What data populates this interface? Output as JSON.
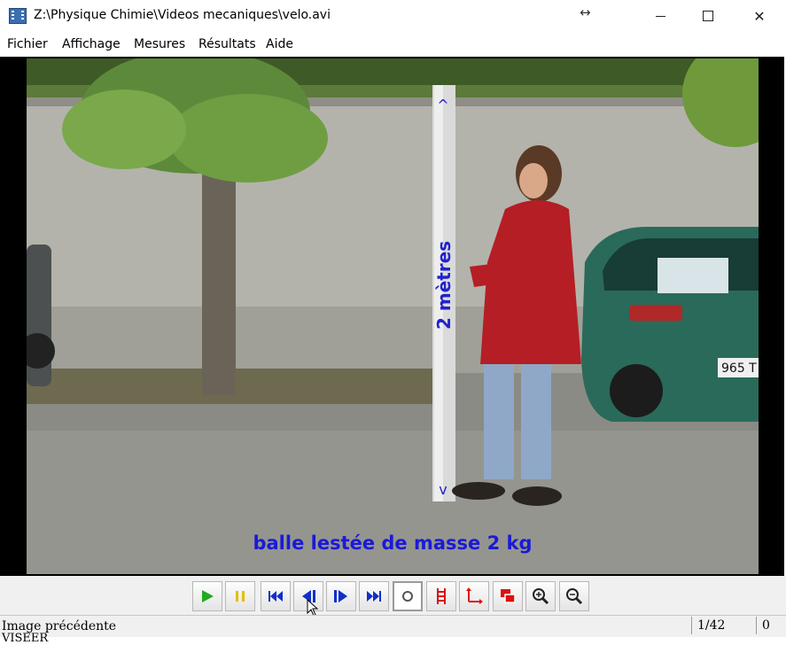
{
  "window": {
    "title": "Z:\\Physique Chimie\\Videos mecaniques\\velo.avi",
    "resize_glyph": "↔",
    "close_glyph": "✕"
  },
  "menu": [
    "Fichier",
    "Affichage",
    "Mesures",
    "Résultats",
    "Aide"
  ],
  "video": {
    "pole_label": "2 mètres",
    "caption": "balle lestée de masse 2 kg",
    "plate": "965 T"
  },
  "toolbar": {
    "buttons": [
      "play-icon",
      "pause-icon",
      "first-frame-icon",
      "previous-frame-icon",
      "next-frame-icon",
      "last-frame-icon",
      "record-point-icon",
      "scale-icon",
      "axes-icon",
      "frame-icon",
      "zoom-in-icon",
      "zoom-out-icon"
    ],
    "pressed": "record-point-icon"
  },
  "status": {
    "message": "Image précédente",
    "frame_counter": "1/42",
    "points": "0",
    "extra": "VISEER"
  },
  "colors": {
    "play": "#22aa22",
    "pause": "#e0c000",
    "nav": "#1030c8",
    "tools": "#dd1010",
    "caption": "#1a1ad6"
  }
}
